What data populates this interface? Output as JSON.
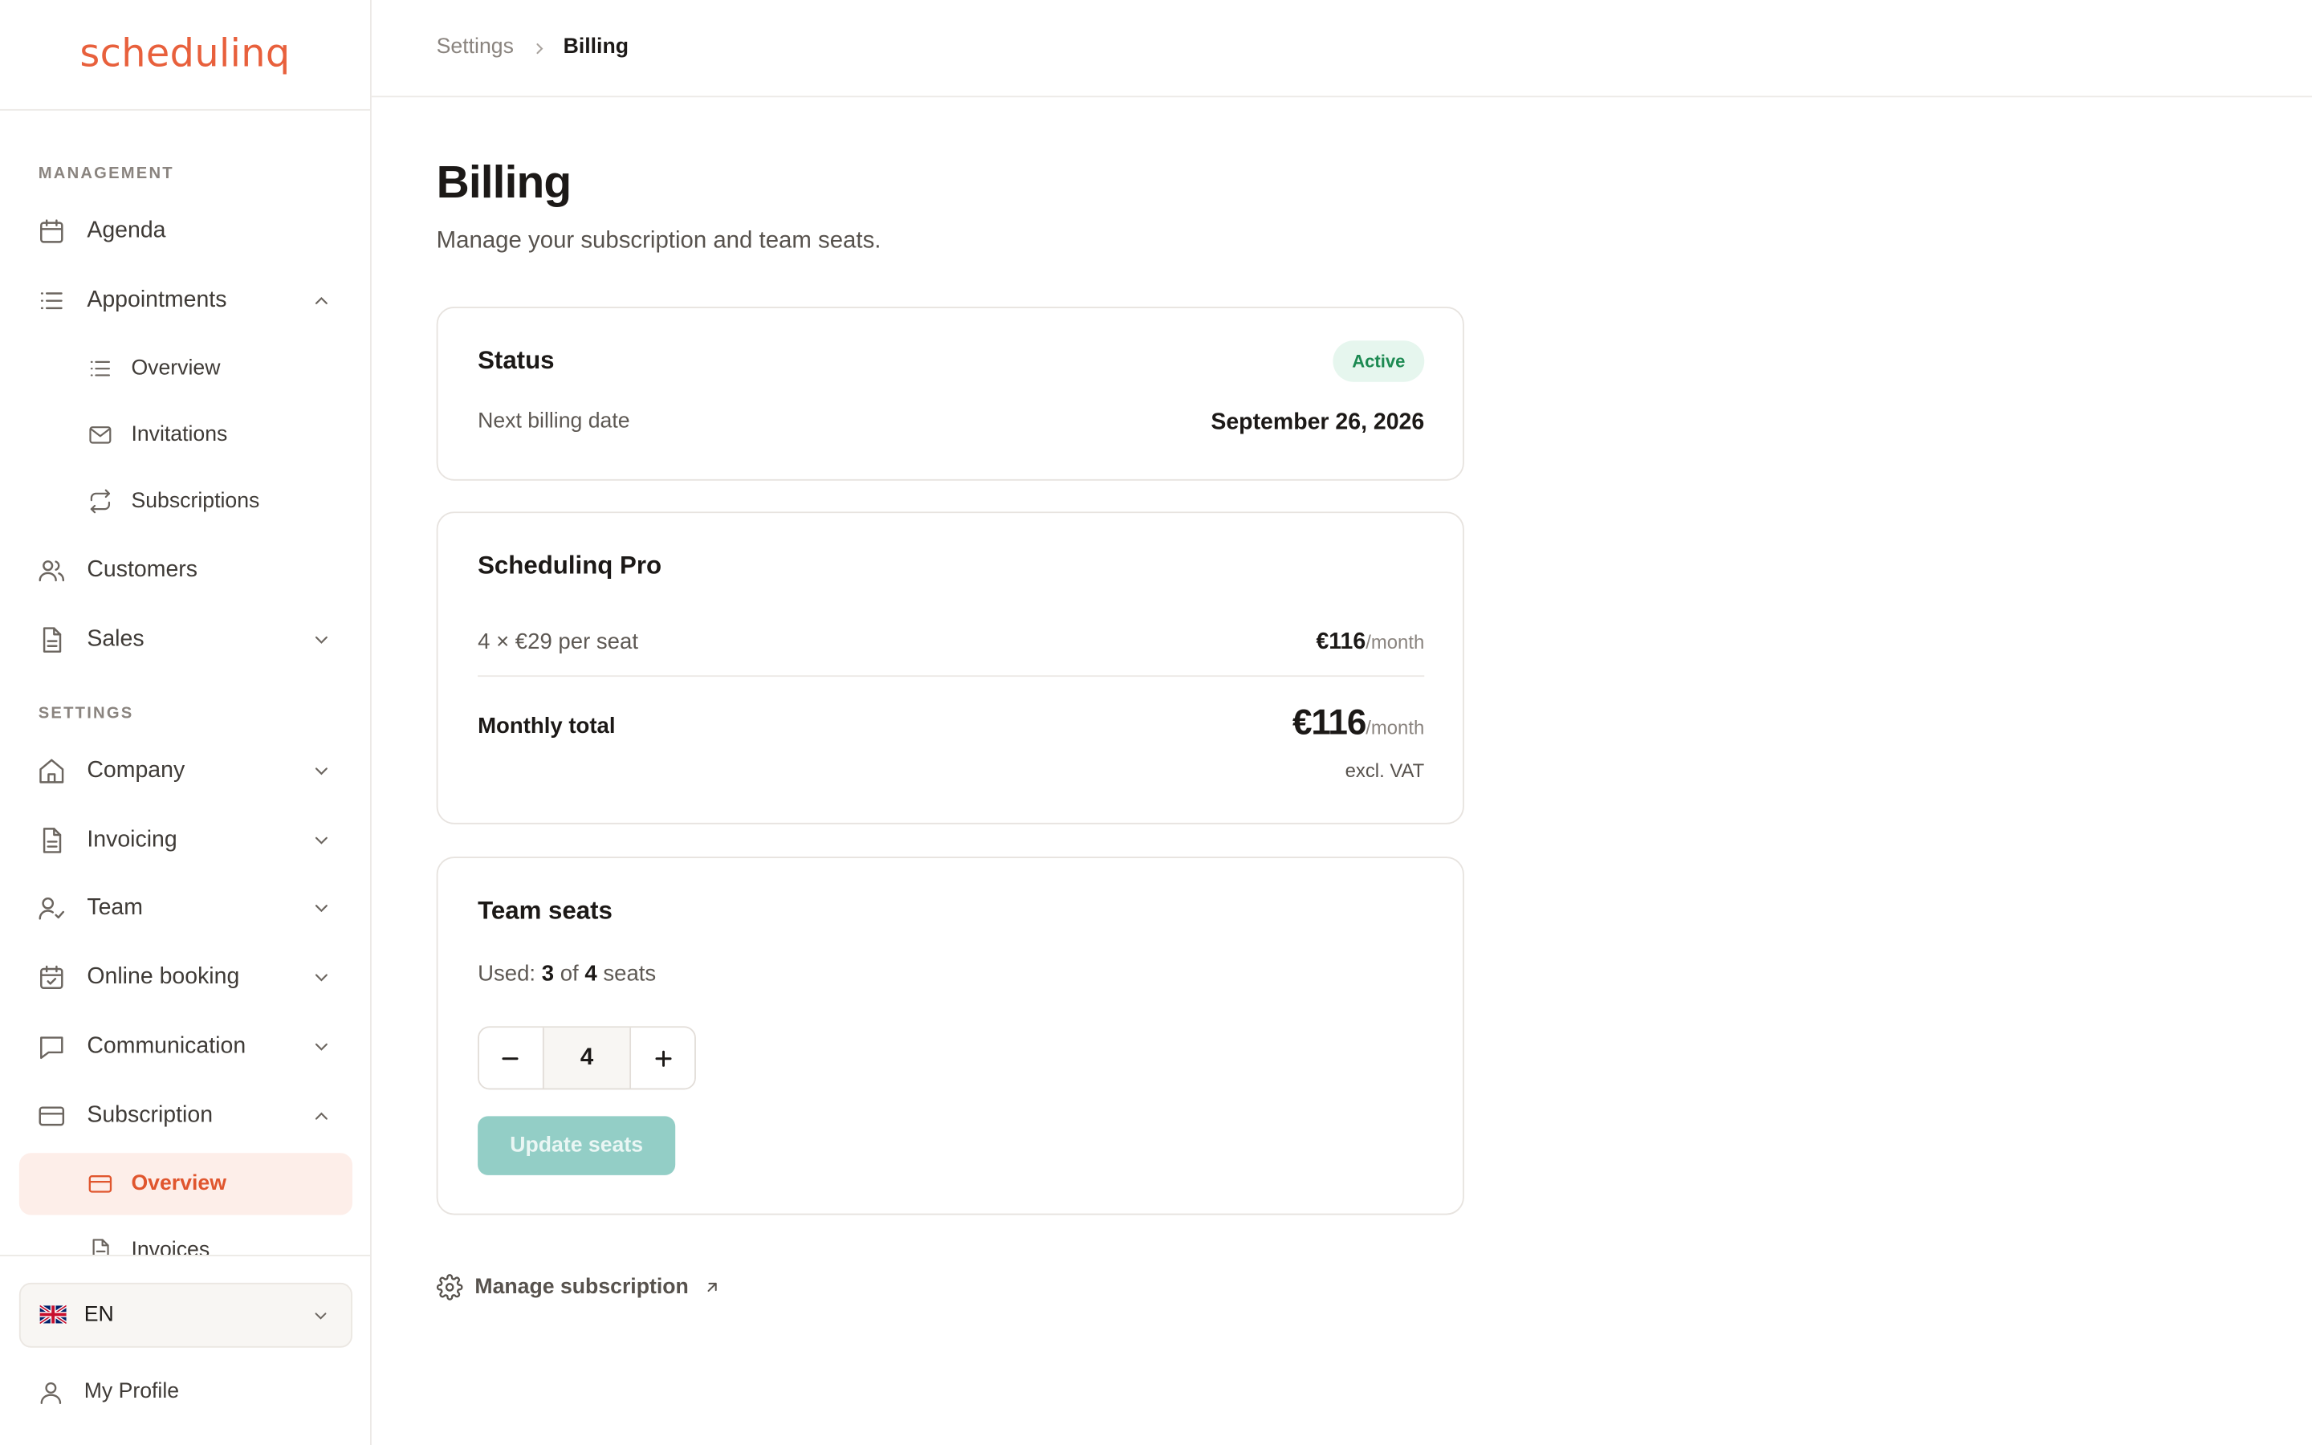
{
  "app": {
    "logo": "schedulinq"
  },
  "breadcrumb": {
    "parent": "Settings",
    "current": "Billing"
  },
  "sidebar": {
    "management_label": "MANAGEMENT",
    "settings_label": "SETTINGS",
    "items": {
      "agenda": "Agenda",
      "appointments": "Appointments",
      "appointments_overview": "Overview",
      "invitations": "Invitations",
      "subscriptions": "Subscriptions",
      "customers": "Customers",
      "sales": "Sales",
      "company": "Company",
      "invoicing": "Invoicing",
      "team": "Team",
      "online_booking": "Online booking",
      "communication": "Communication",
      "subscription": "Subscription",
      "subscription_overview": "Overview",
      "invoices": "Invoices"
    },
    "language": "EN",
    "profile": "My Profile"
  },
  "page": {
    "title": "Billing",
    "subtitle": "Manage your subscription and team seats."
  },
  "status_card": {
    "title": "Status",
    "badge": "Active",
    "next_billing_label": "Next billing date",
    "next_billing_value": "September 26, 2026"
  },
  "plan_card": {
    "title": "Schedulinq Pro",
    "line_label": "4 × €29 per seat",
    "line_amount": "€116",
    "per_month": "/month",
    "total_label": "Monthly total",
    "total_amount": "€116",
    "total_per": "/month",
    "vat_note": "excl. VAT"
  },
  "seats_card": {
    "title": "Team seats",
    "used_prefix": "Used:",
    "used_count": "3",
    "used_of": "of",
    "total_count": "4",
    "used_suffix": "seats",
    "stepper_value": "4",
    "update_button": "Update seats"
  },
  "manage_link": "Manage subscription",
  "colors": {
    "accent": "#e8603c",
    "active_bg": "#fdeee9",
    "success": "#1d8a52",
    "teal_button": "#93cec6"
  }
}
